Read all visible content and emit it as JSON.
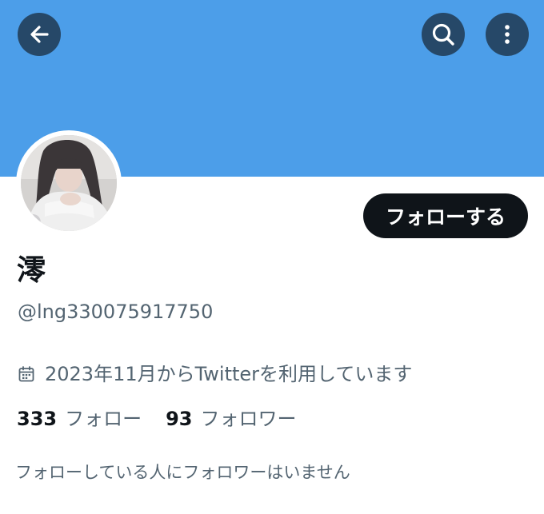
{
  "profile": {
    "display_name": "澪",
    "handle": "@lng330075917750",
    "joined_text": "2023年11月からTwitterを利用しています",
    "following_count": "333",
    "following_label": "フォロー",
    "followers_count": "93",
    "followers_label": "フォロワー",
    "no_followers_you_know": "フォローしている人にフォロワーはいません"
  },
  "actions": {
    "follow_label": "フォローする"
  },
  "icons": {
    "back": "back-arrow-icon",
    "search": "search-icon",
    "more": "more-vertical-icon",
    "calendar": "calendar-icon"
  },
  "colors": {
    "banner": "#4c9ee9",
    "primary_text": "#0f1419",
    "secondary_text": "#536471",
    "follow_button": "#0f1419"
  }
}
